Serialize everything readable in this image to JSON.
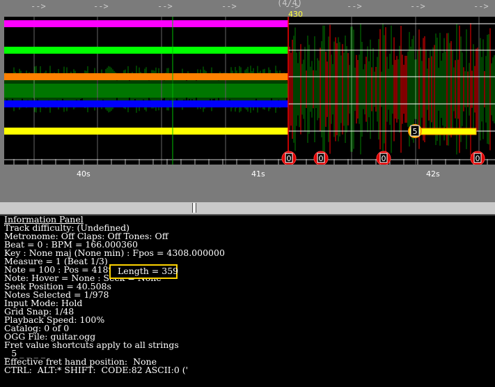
{
  "editor": {
    "beat_arrows": [
      "-->",
      "-->",
      "-->",
      "-->",
      "-->",
      "-->",
      "-->",
      "-->"
    ],
    "measure_label": "(4/4)",
    "measure_number": "430",
    "time_labels": [
      "40s",
      "41s",
      "42s"
    ],
    "note_markers": [
      {
        "fret": "0",
        "flag": "PM"
      },
      {
        "fret": "0",
        "flag": ""
      },
      {
        "fret": "0",
        "flag": ""
      },
      {
        "fret": "0",
        "flag": "PM"
      }
    ],
    "sustain_fret": "5",
    "string_colors": [
      "#ff00ff",
      "#00ff00",
      "#ff8000",
      "#0000ff",
      "#ffff00"
    ],
    "waveform_colors": [
      "#008000",
      "#ff0000"
    ],
    "accent_color": "#ffd400"
  },
  "info_panel": {
    "title": "Information Panel",
    "lines": [
      "Track difficulty: (Undefined)",
      "Metronome: Off Claps: Off Tones: Off",
      "Beat = 0 : BPM = 166.000360",
      "Key : None maj (None min) : Fpos = 4308.000000",
      "Measure = 1 (Beat 1/3)",
      "Note = 100 : Pos = 41898 :",
      "Note: Hover = None : Seek = None",
      "Seek Position = 40.508s",
      "Notes Selected = 1/978",
      "Input Mode: Hold",
      "Grid Snap: 1/48",
      "Playback Speed: 100%",
      "Catalog: 0 of 0",
      "OGG File: guitar.ogg",
      "Fret value shortcuts apply to all strings",
      "_ 5 _ _ _ _",
      "Effective fret hand position:  None",
      "CTRL:  ALT:* SHIFT:  CODE:82 ASCII:0 ('"
    ],
    "highlight": "Length = 359"
  }
}
